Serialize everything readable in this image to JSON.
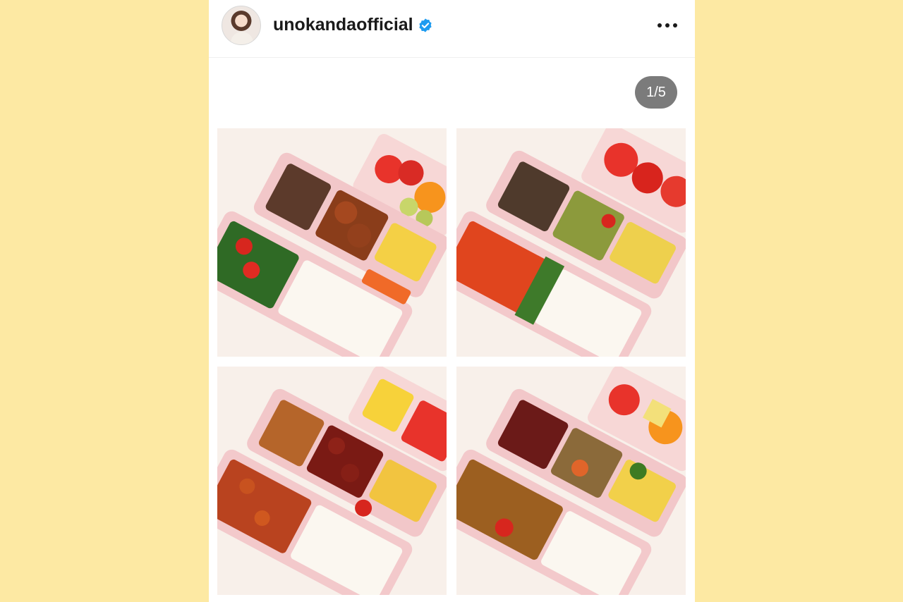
{
  "post": {
    "username": "unokandaofficial",
    "verified": true,
    "carousel_counter": "1/5",
    "menu_icon": "more-horizontal-icon",
    "verified_icon": "verified-badge-icon"
  },
  "colors": {
    "page_background": "#fde9a3",
    "panel_background": "#ffffff",
    "verified_blue": "#1d9bf0",
    "counter_background": "#7b7b7b"
  },
  "photos": [
    {
      "name": "bento-photo-1"
    },
    {
      "name": "bento-photo-2"
    },
    {
      "name": "bento-photo-3"
    },
    {
      "name": "bento-photo-4"
    }
  ]
}
